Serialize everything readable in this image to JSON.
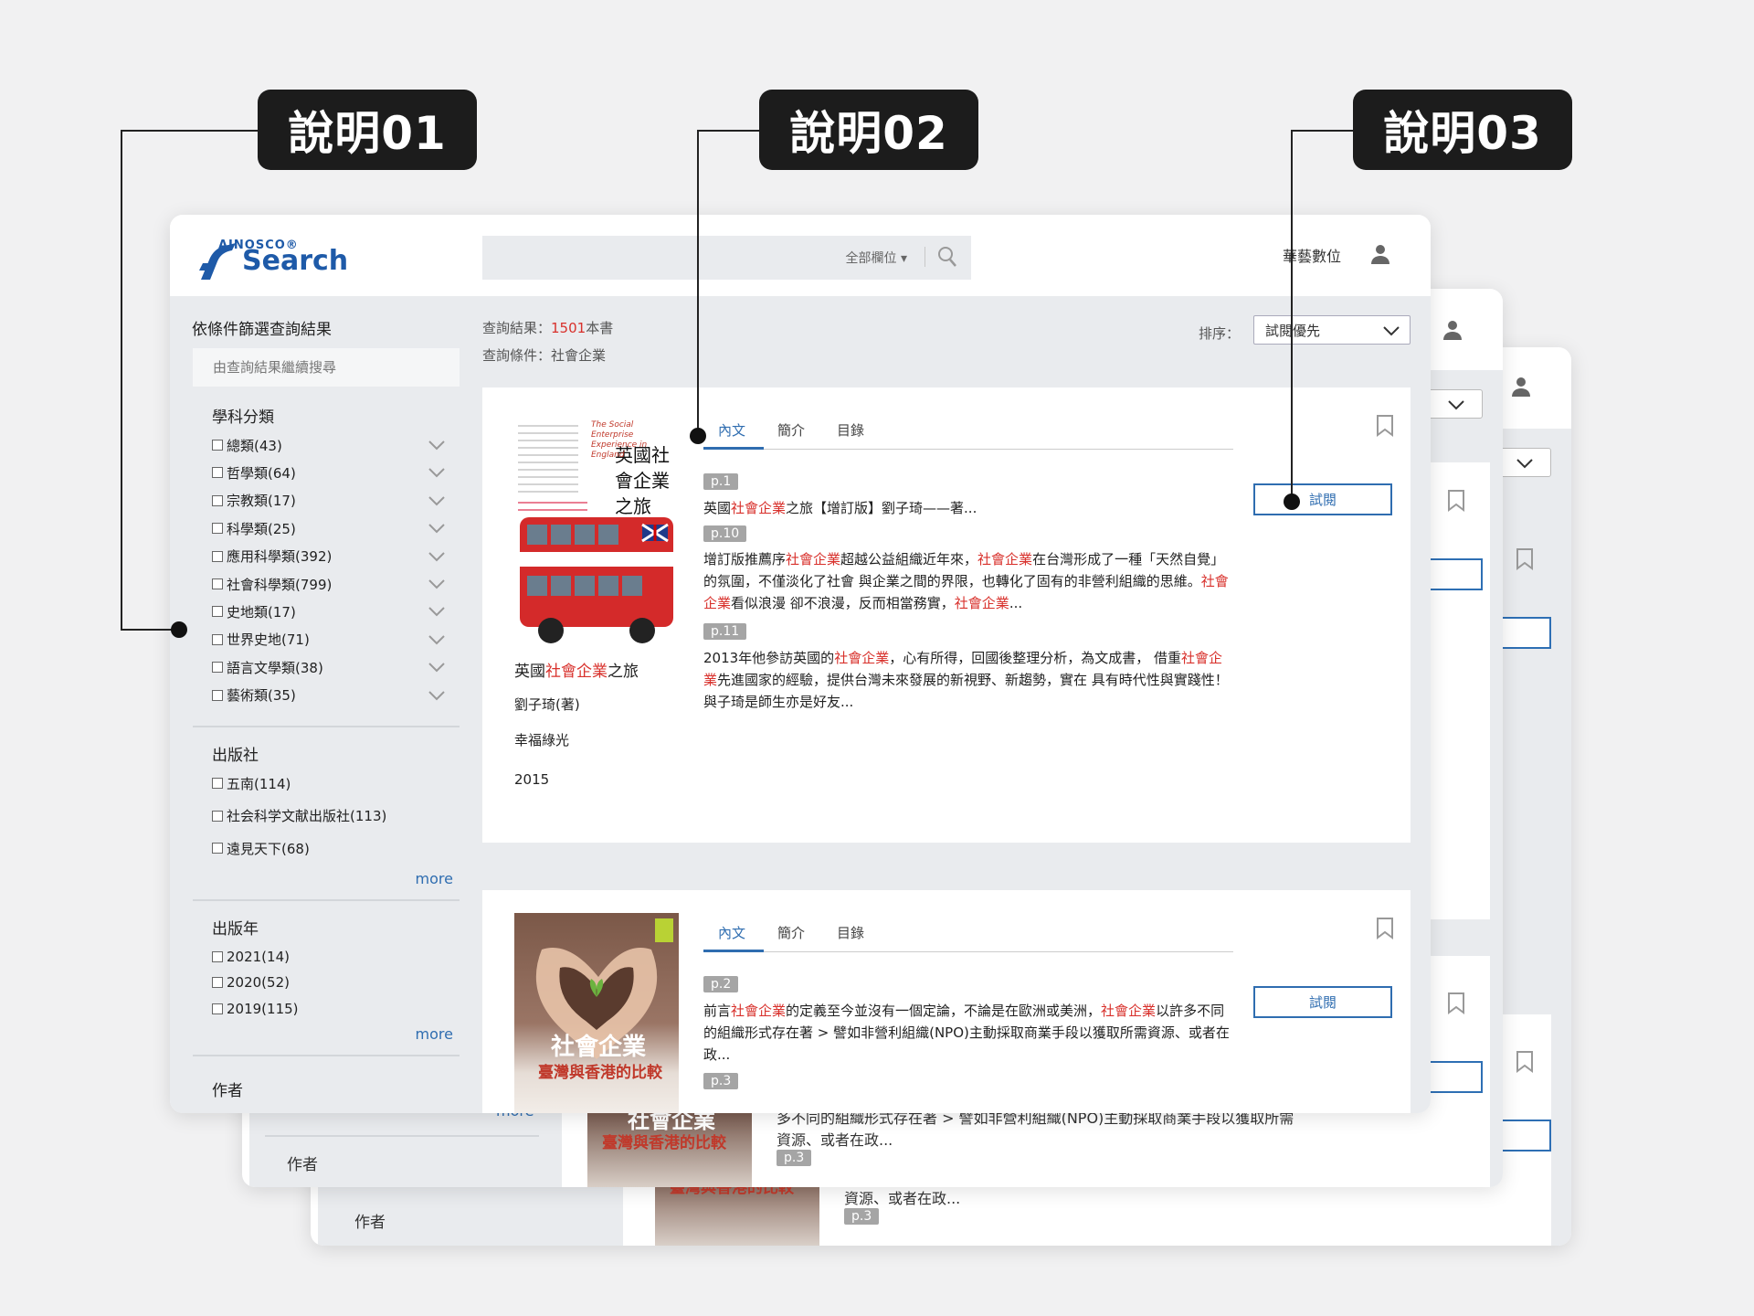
{
  "callouts": [
    "說明01",
    "說明02",
    "說明03"
  ],
  "header": {
    "logo_brand": "AINOSCO®",
    "logo_word": "Search",
    "search_placeholder": "",
    "scope_label": "全部欄位 ▾",
    "user_name": "華藝數位"
  },
  "sidebar": {
    "title": "依條件篩選查詢結果",
    "refine_placeholder": "由查詢結果繼續搜尋",
    "subjects_title": "學科分類",
    "subjects": [
      "總類(43)",
      "哲學類(64)",
      "宗教類(17)",
      "科學類(25)",
      "應用科學類(392)",
      "社會科學類(799)",
      "史地類(17)",
      "世界史地(71)",
      "語言文學類(38)",
      "藝術類(35)"
    ],
    "publisher_title": "出版社",
    "publishers": [
      "五南(114)",
      "社会科学文献出版社(113)",
      "遠見天下(68)"
    ],
    "year_title": "出版年",
    "years": [
      "2021(14)",
      "2020(52)",
      "2019(115)"
    ],
    "more_label": "more",
    "author_title": "作者"
  },
  "results": {
    "count_prefix": "查詢結果：",
    "count": "1501",
    "count_suffix": "本書",
    "query_prefix": "查詢條件：",
    "query": "社會企業",
    "sort_label": "排序：",
    "sort_value": "試閱優先"
  },
  "tabs": [
    "內文",
    "簡介",
    "目錄"
  ],
  "preview_label": "試閱",
  "book1": {
    "title_pre": "英國",
    "title_hl": "社會企業",
    "title_post": "之旅",
    "author": "劉子琦(著)",
    "publisher": "幸福綠光",
    "year": "2015",
    "cover_title": "英國社會企業之旅",
    "cover_en": "The Social Enterprise Experience in England",
    "pages": [
      "p.1",
      "p.10",
      "p.11"
    ],
    "s1_pre": "英國",
    "s1_hl": "社會企業",
    "s1_post": "之旅【增訂版】劉子琦——著...",
    "s2_a": "增訂版推薦序",
    "s2_b": "社會企業",
    "s2_c": "超越公益組織近年來，",
    "s2_d": "社會企業",
    "s2_e": "在台灣形成了一種「天然自覺」的氛圍，不僅淡化了社會 與企業之間的界限，也轉化了固有的非營利組織的思維。",
    "s2_f": "社會企業",
    "s2_g": "看似浪漫 卻不浪漫，反而相當務實，",
    "s2_h": "社會企業",
    "s2_i": "...",
    "s3_a": "2013年他參訪英國的",
    "s3_b": "社會企業",
    "s3_c": "，心有所得，回國後整理分析，為文成書， 借重",
    "s3_d": "社會企業",
    "s3_e": "先進國家的經驗，提供台灣未來發展的新視野、新趨勢，實在 具有時代性與實踐性！ 與子琦是師生亦是好友..."
  },
  "book2": {
    "cover_title": "社會企業",
    "cover_sub": "臺灣與香港的比較",
    "pages": [
      "p.2",
      "p.3"
    ],
    "s1_a": "前言",
    "s1_b": "社會企業",
    "s1_c": "的定義至今並沒有一個定論，不論是在歐洲或美洲，",
    "s1_d": "社會企業",
    "s1_e": "以許多不同的組織形式存在著 > 譬如非營利組織(NPO)主動採取商業手段以獲取所需資源、或者在政..."
  },
  "bg_windows": {
    "author_title": "作者",
    "more_label": "more",
    "cover_sub": "臺灣與香港的比較",
    "cover_title": "社會企業",
    "text_line1": "多不同的組織形式存在著 > 譬如非營利組織(NPO)主動採取商業手段以獲取所需",
    "text_line2": "資源、或者在政...",
    "page_tag": "p.3"
  },
  "colors": {
    "accent": "#2f6db0",
    "highlight": "#d8302b",
    "callout_bg": "#1c1c1c",
    "panel_bg": "#e9ebee"
  }
}
